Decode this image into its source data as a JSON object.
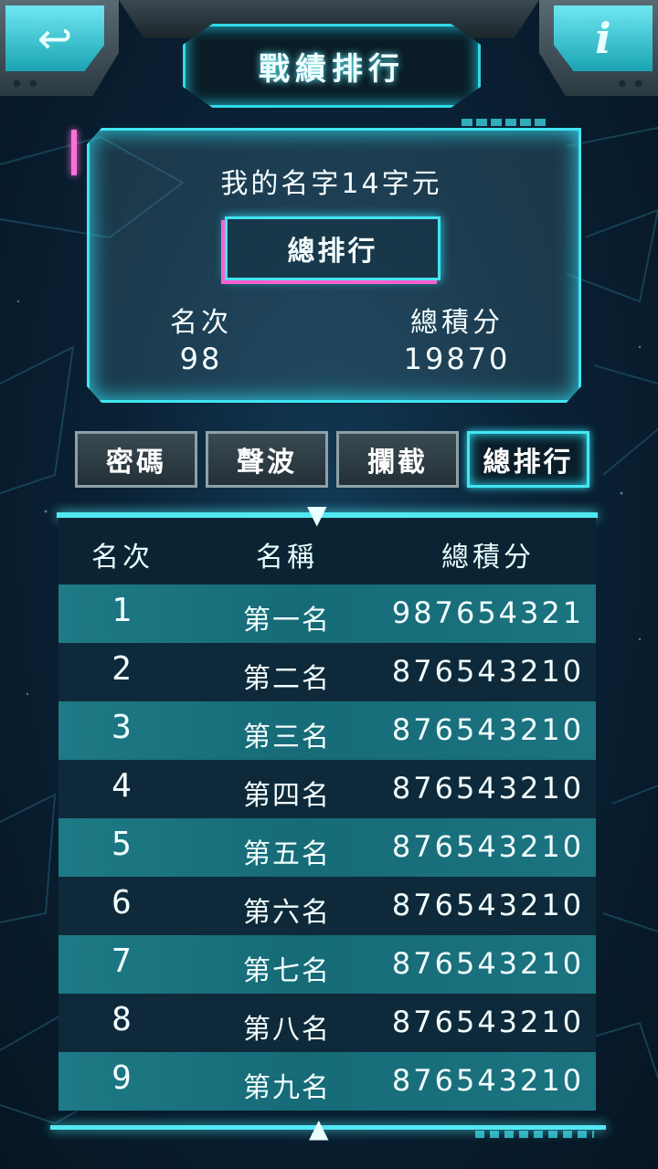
{
  "header": {
    "title": "戰績排行",
    "back_icon": "back-arrow-icon",
    "info_icon": "info-icon",
    "back_symbol": "↩",
    "info_symbol": "i"
  },
  "profile": {
    "player_name": "我的名字14字元",
    "ranking_type": "總排行",
    "rank_label": "名次",
    "rank_value": "98",
    "score_label": "總積分",
    "score_value": "19870"
  },
  "tabs": [
    {
      "label": "密碼",
      "active": false
    },
    {
      "label": "聲波",
      "active": false
    },
    {
      "label": "攔截",
      "active": false
    },
    {
      "label": "總排行",
      "active": true
    }
  ],
  "table": {
    "headers": {
      "rank": "名次",
      "name": "名稱",
      "score": "總積分"
    },
    "rows": [
      {
        "rank": "1",
        "name": "第一名",
        "score": "987654321"
      },
      {
        "rank": "2",
        "name": "第二名",
        "score": "876543210"
      },
      {
        "rank": "3",
        "name": "第三名",
        "score": "876543210"
      },
      {
        "rank": "4",
        "name": "第四名",
        "score": "876543210"
      },
      {
        "rank": "5",
        "name": "第五名",
        "score": "876543210"
      },
      {
        "rank": "6",
        "name": "第六名",
        "score": "876543210"
      },
      {
        "rank": "7",
        "name": "第七名",
        "score": "876543210"
      },
      {
        "rank": "8",
        "name": "第八名",
        "score": "876543210"
      },
      {
        "rank": "9",
        "name": "第九名",
        "score": "876543210"
      }
    ]
  },
  "colors": {
    "accent": "#40e6f2",
    "pink_accent": "#ff6ed6",
    "row_highlight": "#1e7a86",
    "row_dark": "#0e2a3a"
  }
}
